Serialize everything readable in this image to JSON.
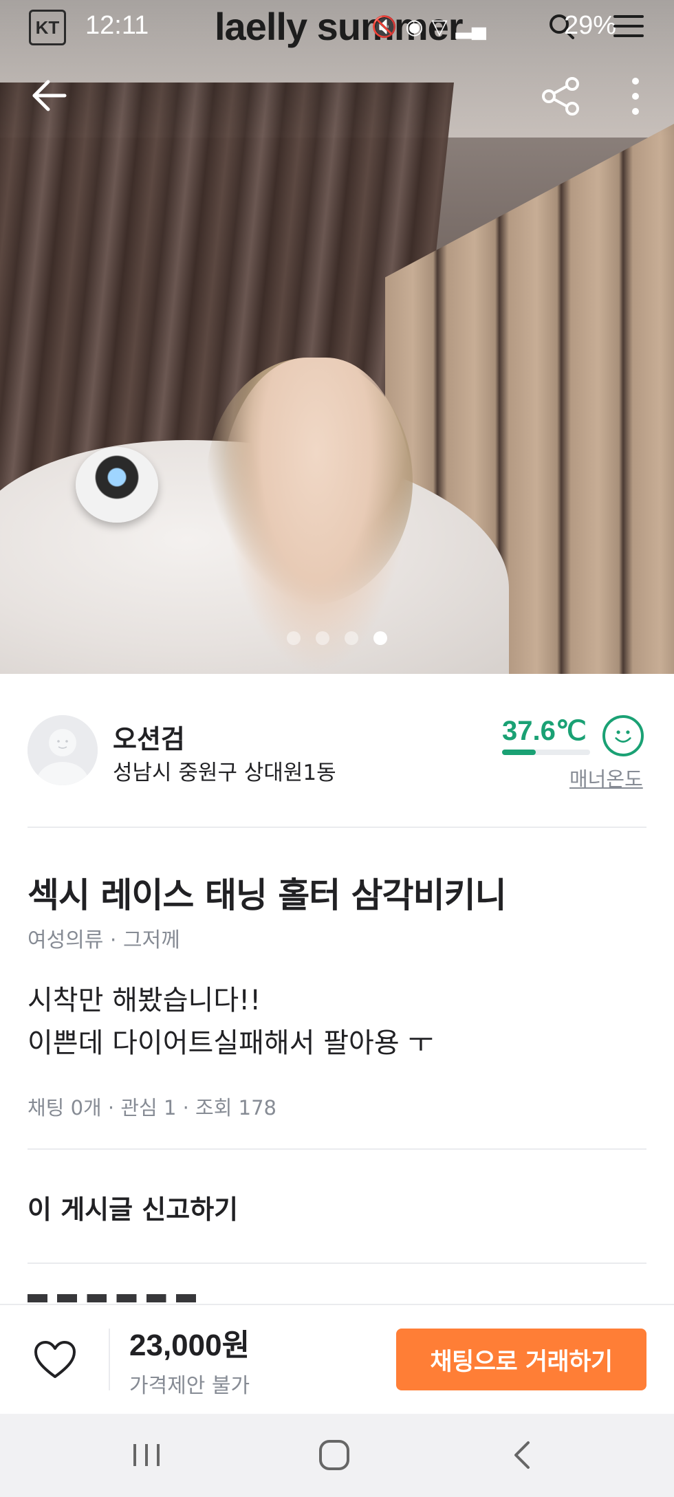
{
  "status_bar": {
    "carrier": "KT",
    "time": "12:11",
    "notification_title": "laelly summer",
    "battery": "29%"
  },
  "gallery": {
    "image_count": 4,
    "active_index": 3
  },
  "seller": {
    "name": "오션검",
    "location": "성남시 중원구 상대원1동",
    "manner_temperature": "37.6℃",
    "manner_label": "매너온도",
    "manner_color": "#1aa174"
  },
  "post": {
    "title": "섹시 레이스 태닝 홀터 삼각비키니",
    "meta": "여성의류 · 그저께",
    "description_lines": [
      "시착만 해봤습니다!!",
      "이쁜데 다이어트실패해서 팔아용 ㅜ"
    ],
    "stats": "채팅 0개 · 관심 1 · 조회 178",
    "report_label": "이 게시글 신고하기"
  },
  "bottom_bar": {
    "price": "23,000원",
    "price_note": "가격제안 불가",
    "chat_button_label": "채팅으로 거래하기",
    "accent_color": "#ff7e36"
  },
  "icons": {
    "back": "arrow-left-icon",
    "share": "share-icon",
    "more": "more-vertical-icon",
    "like": "heart-outline-icon",
    "search": "search-icon",
    "menu": "menu-icon",
    "nav_recents": "recents-icon",
    "nav_home": "home-icon",
    "nav_back": "chevron-left-icon"
  }
}
